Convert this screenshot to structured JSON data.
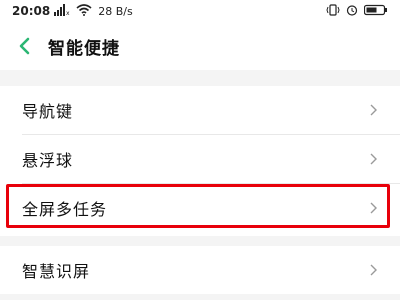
{
  "status_bar": {
    "time": "20:08",
    "network_speed": "28 B/s",
    "icons_left": [
      "sim-signal-icon",
      "wifi-icon"
    ],
    "icons_right": [
      "vibrate-icon",
      "alarm-icon",
      "battery-icon"
    ]
  },
  "header": {
    "title": "智能便捷",
    "back_icon": "chevron-left-icon",
    "accent_color": "#2bb673"
  },
  "list": {
    "items": [
      {
        "label": "导航键",
        "chevron": "chevron-right-icon"
      },
      {
        "label": "悬浮球",
        "chevron": "chevron-right-icon"
      },
      {
        "label": "全屏多任务",
        "chevron": "chevron-right-icon",
        "highlighted": true
      },
      {
        "label": "智慧识屏",
        "chevron": "chevron-right-icon"
      }
    ]
  },
  "highlight_color": "#e8000a"
}
